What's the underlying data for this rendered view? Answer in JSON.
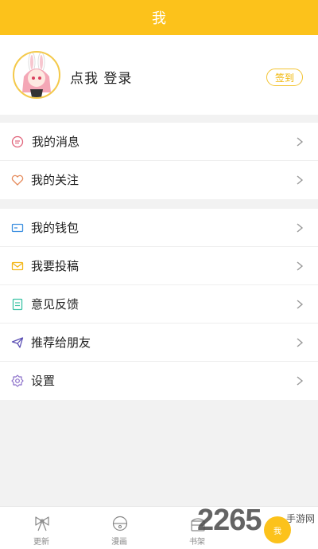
{
  "header": {
    "title": "我"
  },
  "profile": {
    "login_text": "点我 登录",
    "checkin_label": "签到"
  },
  "group1": [
    {
      "label": "我的消息",
      "icon": "message-icon",
      "color": "#e0637a"
    },
    {
      "label": "我的关注",
      "icon": "heart-icon",
      "color": "#e58a5a"
    }
  ],
  "group2": [
    {
      "label": "我的钱包",
      "icon": "wallet-icon",
      "color": "#3b8fe0"
    },
    {
      "label": "我要投稿",
      "icon": "mail-icon",
      "color": "#f3b71a"
    },
    {
      "label": "意见反馈",
      "icon": "feedback-icon",
      "color": "#3cc3a5"
    },
    {
      "label": "推荐给朋友",
      "icon": "send-icon",
      "color": "#5b4fb4"
    },
    {
      "label": "设置",
      "icon": "gear-icon",
      "color": "#8b6fc9"
    }
  ],
  "tabs": [
    {
      "label": "更新",
      "icon": "bow-icon"
    },
    {
      "label": "漫画",
      "icon": "bell-icon"
    },
    {
      "label": "书架",
      "icon": "bookshelf-icon"
    },
    {
      "label": "我",
      "icon": "me-icon"
    }
  ],
  "watermark": {
    "brand": "2265",
    "suffix": "手游网"
  },
  "colors": {
    "accent": "#fcc21b"
  }
}
